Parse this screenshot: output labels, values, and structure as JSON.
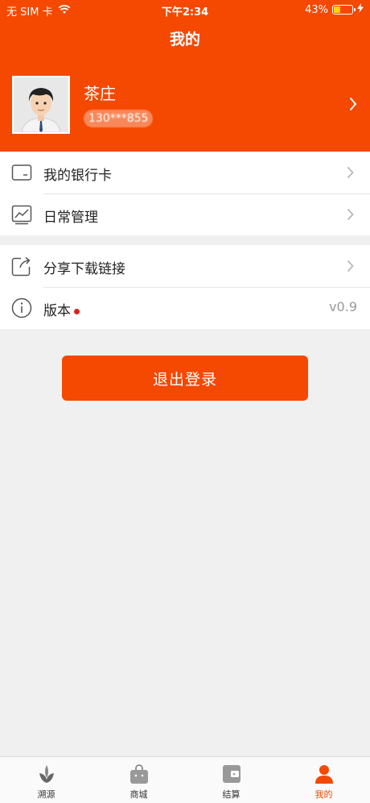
{
  "status_bar": {
    "carrier": "无 SIM 卡",
    "time": "下午2:34",
    "battery": "43%",
    "battery_level": 0.43
  },
  "nav": {
    "title": "我的"
  },
  "profile": {
    "name": "茶庄",
    "phone": "130***855"
  },
  "menu_group_1": [
    {
      "label": "我的银行卡",
      "icon": "bank-card-icon"
    },
    {
      "label": "日常管理",
      "icon": "chart-icon"
    }
  ],
  "menu_group_2": [
    {
      "label": "分享下载链接",
      "icon": "share-icon"
    },
    {
      "label": "版本",
      "icon": "info-icon",
      "value": "v0.9",
      "badge": true
    }
  ],
  "logout": {
    "label": "退出登录"
  },
  "tabbar": [
    {
      "label": "溯源",
      "icon": "leaf-icon"
    },
    {
      "label": "商城",
      "icon": "shopping-bag-icon"
    },
    {
      "label": "结算",
      "icon": "wallet-icon"
    },
    {
      "label": "我的",
      "icon": "person-icon",
      "active": true
    }
  ],
  "colors": {
    "accent": "#f54800",
    "background": "#f0f0f0",
    "badge": "#e0201b"
  }
}
